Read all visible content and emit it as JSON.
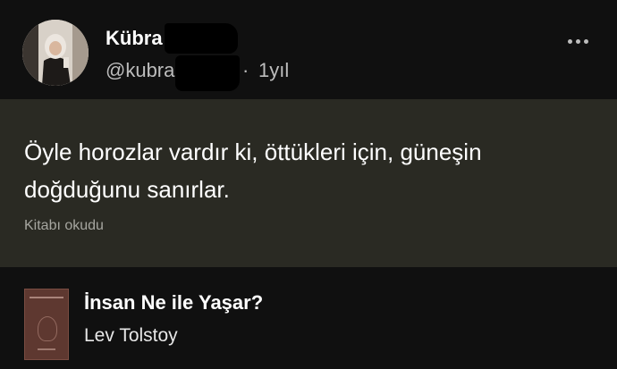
{
  "author": {
    "name": "Kübra",
    "handle": "@kubra",
    "separator": "·",
    "time": "1yıl"
  },
  "quote": {
    "text": "Öyle horozlar vardır ki, öttükleri için, güneşin doğduğunu sanırlar.",
    "activity": "Kitabı okudu",
    "background": "#2a2a23"
  },
  "book": {
    "title": "İnsan Ne ile Yaşar?",
    "author": "Lev Tolstoy",
    "cover_color": "#5e3830"
  },
  "icons": {
    "more": "more-horizontal-icon",
    "avatar": "user-avatar"
  }
}
